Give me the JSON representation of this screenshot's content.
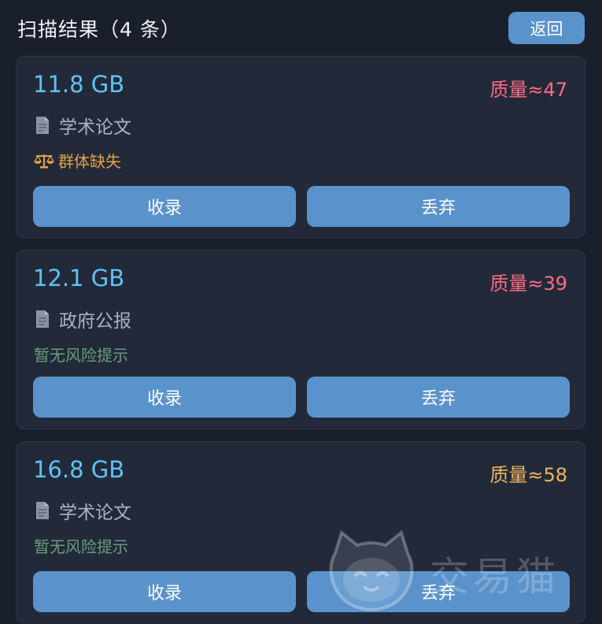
{
  "header": {
    "title": "扫描结果（4 条）",
    "back_label": "返回"
  },
  "cards": [
    {
      "size": "11.8 GB",
      "quality": "质量≈47",
      "quality_color": "#ff6b81",
      "category": "学术论文",
      "risk": "群体缺失",
      "risk_color": "#e6a23c",
      "risk_icon": "scale-icon",
      "collect_label": "收录",
      "discard_label": "丢弃"
    },
    {
      "size": "12.1 GB",
      "quality": "质量≈39",
      "quality_color": "#ff6b81",
      "category": "政府公报",
      "risk": "暂无风险提示",
      "risk_color": "#6a9c7c",
      "collect_label": "收录",
      "discard_label": "丢弃"
    },
    {
      "size": "16.8 GB",
      "quality": "质量≈58",
      "quality_color": "#f0b35e",
      "category": "学术论文",
      "risk": "暂无风险提示",
      "risk_color": "#6a9c7c",
      "collect_label": "收录",
      "discard_label": "丢弃"
    }
  ],
  "watermark": {
    "text": "交易猫",
    "icon": "cat-logo-icon"
  },
  "colors": {
    "background": "#1a1f2c",
    "card": "#222a3a",
    "button": "#5a93cc",
    "size_text": "#5dc3f0"
  }
}
